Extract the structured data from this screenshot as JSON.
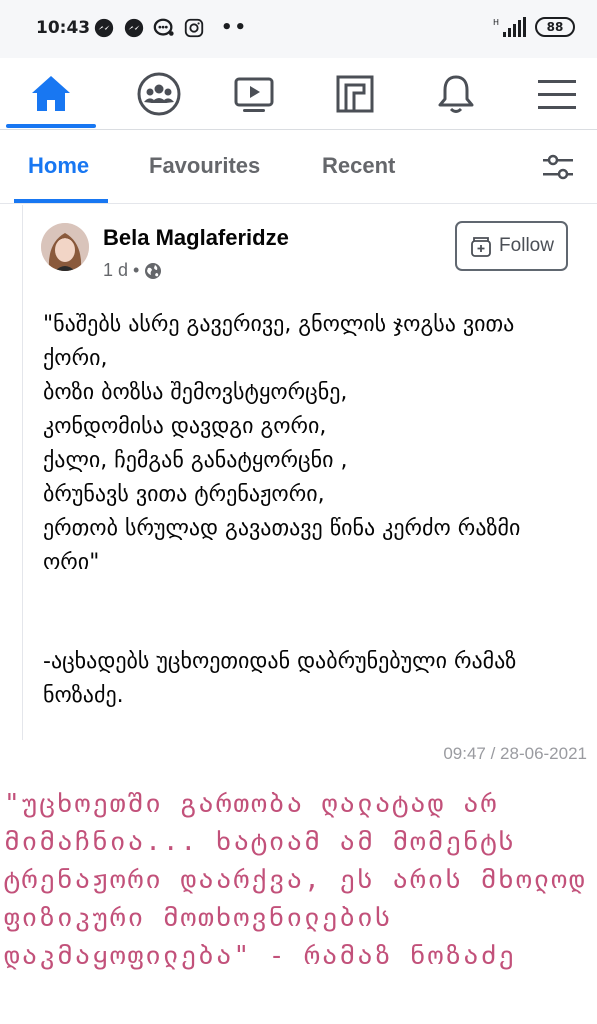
{
  "status_bar": {
    "time": "10:43",
    "dots": "••",
    "battery": "88",
    "network": "H"
  },
  "nav": {
    "items": [
      {
        "name": "home",
        "icon": "home-icon",
        "active": true
      },
      {
        "name": "groups",
        "icon": "groups-icon",
        "active": false
      },
      {
        "name": "watch",
        "icon": "video-icon",
        "active": false
      },
      {
        "name": "pages",
        "icon": "pages-icon",
        "active": false
      },
      {
        "name": "notifications",
        "icon": "bell-icon",
        "active": false
      },
      {
        "name": "menu",
        "icon": "hamburger-icon",
        "active": false
      }
    ],
    "accent": "#1877f2"
  },
  "tabs": {
    "home": "Home",
    "favourites": "Favourites",
    "recent": "Recent"
  },
  "post": {
    "author": "Bela Maglaferidze",
    "time_ago": "1 d",
    "separator": "•",
    "follow_label": "Follow",
    "text": "\"ნაშებს ასრე გავერივე, გნოლის ჯოგსა ვითა ქორი,\nბოზი ბოზსა შემოვსტყორცნე,\nკონდომისა დავდგი გორი,\nქალი, ჩემგან განატყორცნი ,\nბრუნავს ვითა ტრენაჟორი,\nერთობ სრულად გავათავე წინა კერძო რაზმი ორი\"",
    "signature": "-აცხადებს უცხოეთიდან დაბრუნებული რამაზ ნოზაძე."
  },
  "timestamp": "09:47 / 28-06-2021",
  "quote": "\"უცხოეთში გართობა ღალატად არ მიმაჩნია... ხატიამ ამ მომენტს ტრენაჟორი დაარქვა, ეს არის მხოლოდ ფიზიკური მოთხოვნილების დაკმაყოფილება\" - რამაზ ნოზაძე",
  "colors": {
    "quote": "#c2517a",
    "inactive_icon": "#4b4f56"
  }
}
